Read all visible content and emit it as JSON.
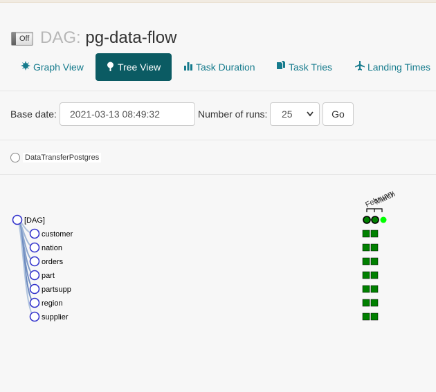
{
  "dag": {
    "toggle_label": "Off",
    "title_prefix": "DAG:",
    "dag_id": "pg-data-flow"
  },
  "tabs": [
    {
      "label": "Graph View",
      "icon": "sun-icon"
    },
    {
      "label": "Tree View",
      "icon": "tree-icon",
      "active": true
    },
    {
      "label": "Task Duration",
      "icon": "bar-chart-icon"
    },
    {
      "label": "Task Tries",
      "icon": "files-icon"
    },
    {
      "label": "Landing Times",
      "icon": "plane-icon"
    }
  ],
  "form": {
    "base_date_label": "Base date:",
    "base_date_value": "2021-03-13 08:49:32",
    "runs_label": "Number of runs:",
    "runs_value": "25",
    "go_label": "Go"
  },
  "legend": {
    "operator_label": "DataTransferPostgres"
  },
  "tree": {
    "root_label": "[DAG]",
    "tasks": [
      "customer",
      "nation",
      "orders",
      "part",
      "partsupp",
      "region",
      "supplier"
    ],
    "run_headers": [
      "February",
      "March"
    ],
    "dag_run_states": [
      "success",
      "success",
      "running"
    ],
    "task_instance_states": [
      "success",
      "success"
    ]
  },
  "colors": {
    "accent": "#167b8d",
    "active_tab": "#0b5b63",
    "success": "#008000",
    "running": "#00ff00",
    "node_border": "#3434cc"
  }
}
